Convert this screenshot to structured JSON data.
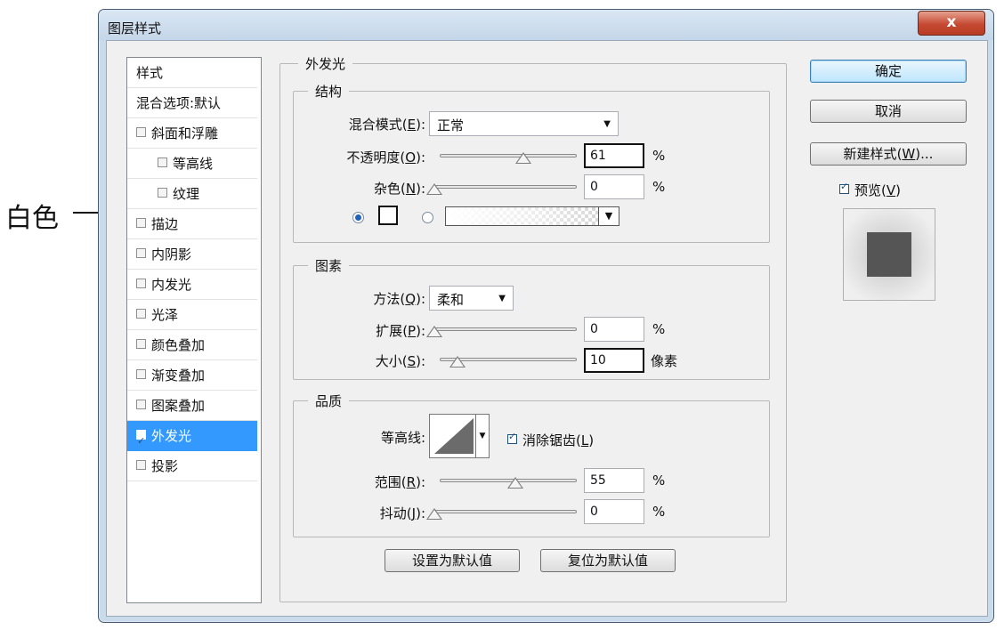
{
  "annotation": {
    "label": "白色"
  },
  "window": {
    "title": "图层样式",
    "close_glyph": "x"
  },
  "style_list": {
    "header": "样式",
    "blend": "混合选项:默认",
    "items": [
      {
        "label": "斜面和浮雕",
        "checked": false
      },
      {
        "label": "等高线",
        "checked": false
      },
      {
        "label": "纹理",
        "checked": false
      },
      {
        "label": "描边",
        "checked": false
      },
      {
        "label": "内阴影",
        "checked": false
      },
      {
        "label": "内发光",
        "checked": false
      },
      {
        "label": "光泽",
        "checked": false
      },
      {
        "label": "颜色叠加",
        "checked": false
      },
      {
        "label": "渐变叠加",
        "checked": false
      },
      {
        "label": "图案叠加",
        "checked": false
      },
      {
        "label": "外发光",
        "checked": true,
        "selected": true
      },
      {
        "label": "投影",
        "checked": false
      }
    ]
  },
  "panel": {
    "title": "外发光",
    "structure": {
      "legend": "结构",
      "blend_mode_label": "混合模式",
      "blend_mode_key": "E",
      "blend_mode_value": "正常",
      "opacity_label": "不透明度",
      "opacity_key": "O",
      "opacity_value": "61",
      "opacity_fraction": 0.61,
      "noise_label": "杂色",
      "noise_key": "N",
      "noise_value": "0",
      "noise_fraction": 0,
      "percent": "%"
    },
    "elements": {
      "legend": "图素",
      "technique_label": "方法",
      "technique_key": "Q",
      "technique_value": "柔和",
      "spread_label": "扩展",
      "spread_key": "P",
      "spread_value": "0",
      "spread_fraction": 0,
      "size_label": "大小",
      "size_key": "S",
      "size_value": "10",
      "size_unit": "像素",
      "percent": "%"
    },
    "quality": {
      "legend": "品质",
      "contour_label": "等高线:",
      "antialias_label": "消除锯齿",
      "antialias_key": "L",
      "antialias_checked": true,
      "range_label": "范围",
      "range_key": "R",
      "range_value": "55",
      "range_fraction": 0.55,
      "jitter_label": "抖动",
      "jitter_key": "J",
      "jitter_value": "0",
      "jitter_fraction": 0,
      "percent": "%"
    },
    "buttons": {
      "make_default": "设置为默认值",
      "reset_default": "复位为默认值"
    }
  },
  "right": {
    "ok": "确定",
    "cancel": "取消",
    "new_style": "新建样式",
    "new_style_key": "W",
    "new_style_suffix": "...",
    "preview_label": "预览",
    "preview_key": "V",
    "preview_checked": true
  },
  "colors": {
    "selection": "#3399ff",
    "glow_color": "#ffffff",
    "preview_swatch": "#555555"
  }
}
